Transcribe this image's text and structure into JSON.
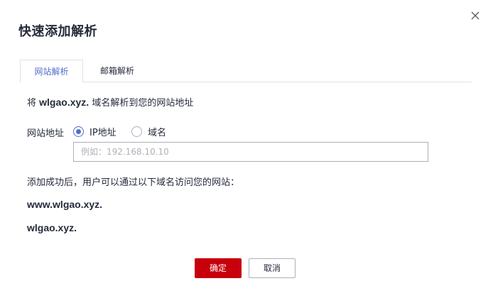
{
  "dialog": {
    "title": "快速添加解析",
    "close_icon": "close-icon"
  },
  "tabs": [
    {
      "label": "网站解析",
      "active": true
    },
    {
      "label": "邮箱解析",
      "active": false
    }
  ],
  "description": {
    "prefix": "将",
    "domain": "wlgao.xyz.",
    "suffix": "域名解析到您的网站地址"
  },
  "form": {
    "label": "网站地址",
    "options": [
      {
        "label": "IP地址",
        "checked": true
      },
      {
        "label": "域名",
        "checked": false
      }
    ],
    "input_value": "",
    "input_placeholder": "例如：192.168.10.10"
  },
  "result": {
    "text": "添加成功后，用户可以通过以下域名访问您的网站：",
    "sites": [
      "www.wlgao.xyz.",
      "wlgao.xyz."
    ]
  },
  "buttons": {
    "ok": "确定",
    "cancel": "取消"
  },
  "colors": {
    "accent": "#526ecc",
    "primary_button": "#c7000b",
    "border": "#adb0b8"
  }
}
